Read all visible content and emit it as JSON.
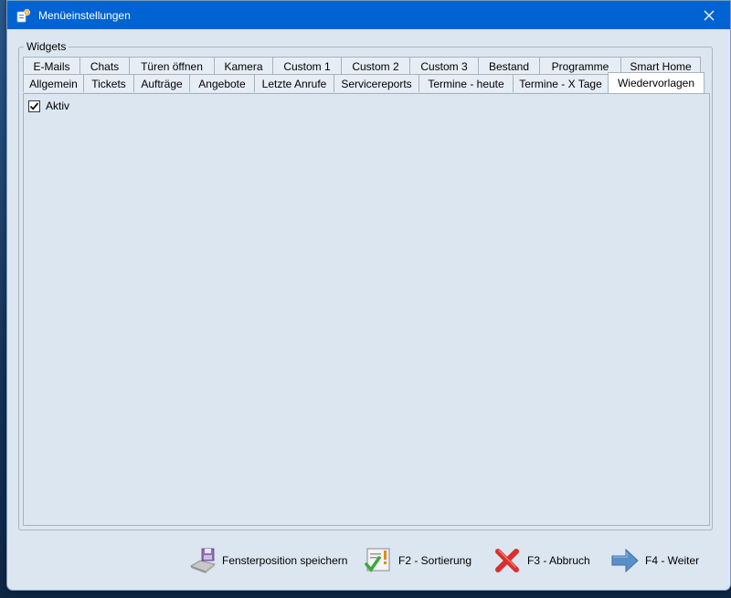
{
  "window": {
    "title": "Menüeinstellungen",
    "app_icon": "settings-app-icon",
    "close_icon": "close-icon"
  },
  "widgets": {
    "group_label": "Widgets",
    "tabs_row1": [
      "E-Mails",
      "Chats",
      "Türen öffnen",
      "Kamera",
      "Custom 1",
      "Custom 2",
      "Custom 3",
      "Bestand",
      "Programme",
      "Smart Home"
    ],
    "tabs_row2": [
      "Allgemein",
      "Tickets",
      "Aufträge",
      "Angebote",
      "Letzte Anrufe",
      "Servicereports",
      "Termine - heute",
      "Termine - X Tage",
      "Wiedervorlagen"
    ],
    "active_tab": "Wiedervorlagen",
    "checkbox": {
      "label": "Aktiv",
      "checked": true
    }
  },
  "footer": {
    "save_position": "Fensterposition speichern",
    "sort": "F2 - Sortierung",
    "cancel": "F3 - Abbruch",
    "next": "F4 - Weiter"
  },
  "colors": {
    "titlebar": "#0063d1",
    "dialog_bg": "#dce6f1",
    "cancel_red": "#d9302c",
    "next_blue": "#5b8fc7",
    "check_green": "#3aa93a"
  }
}
